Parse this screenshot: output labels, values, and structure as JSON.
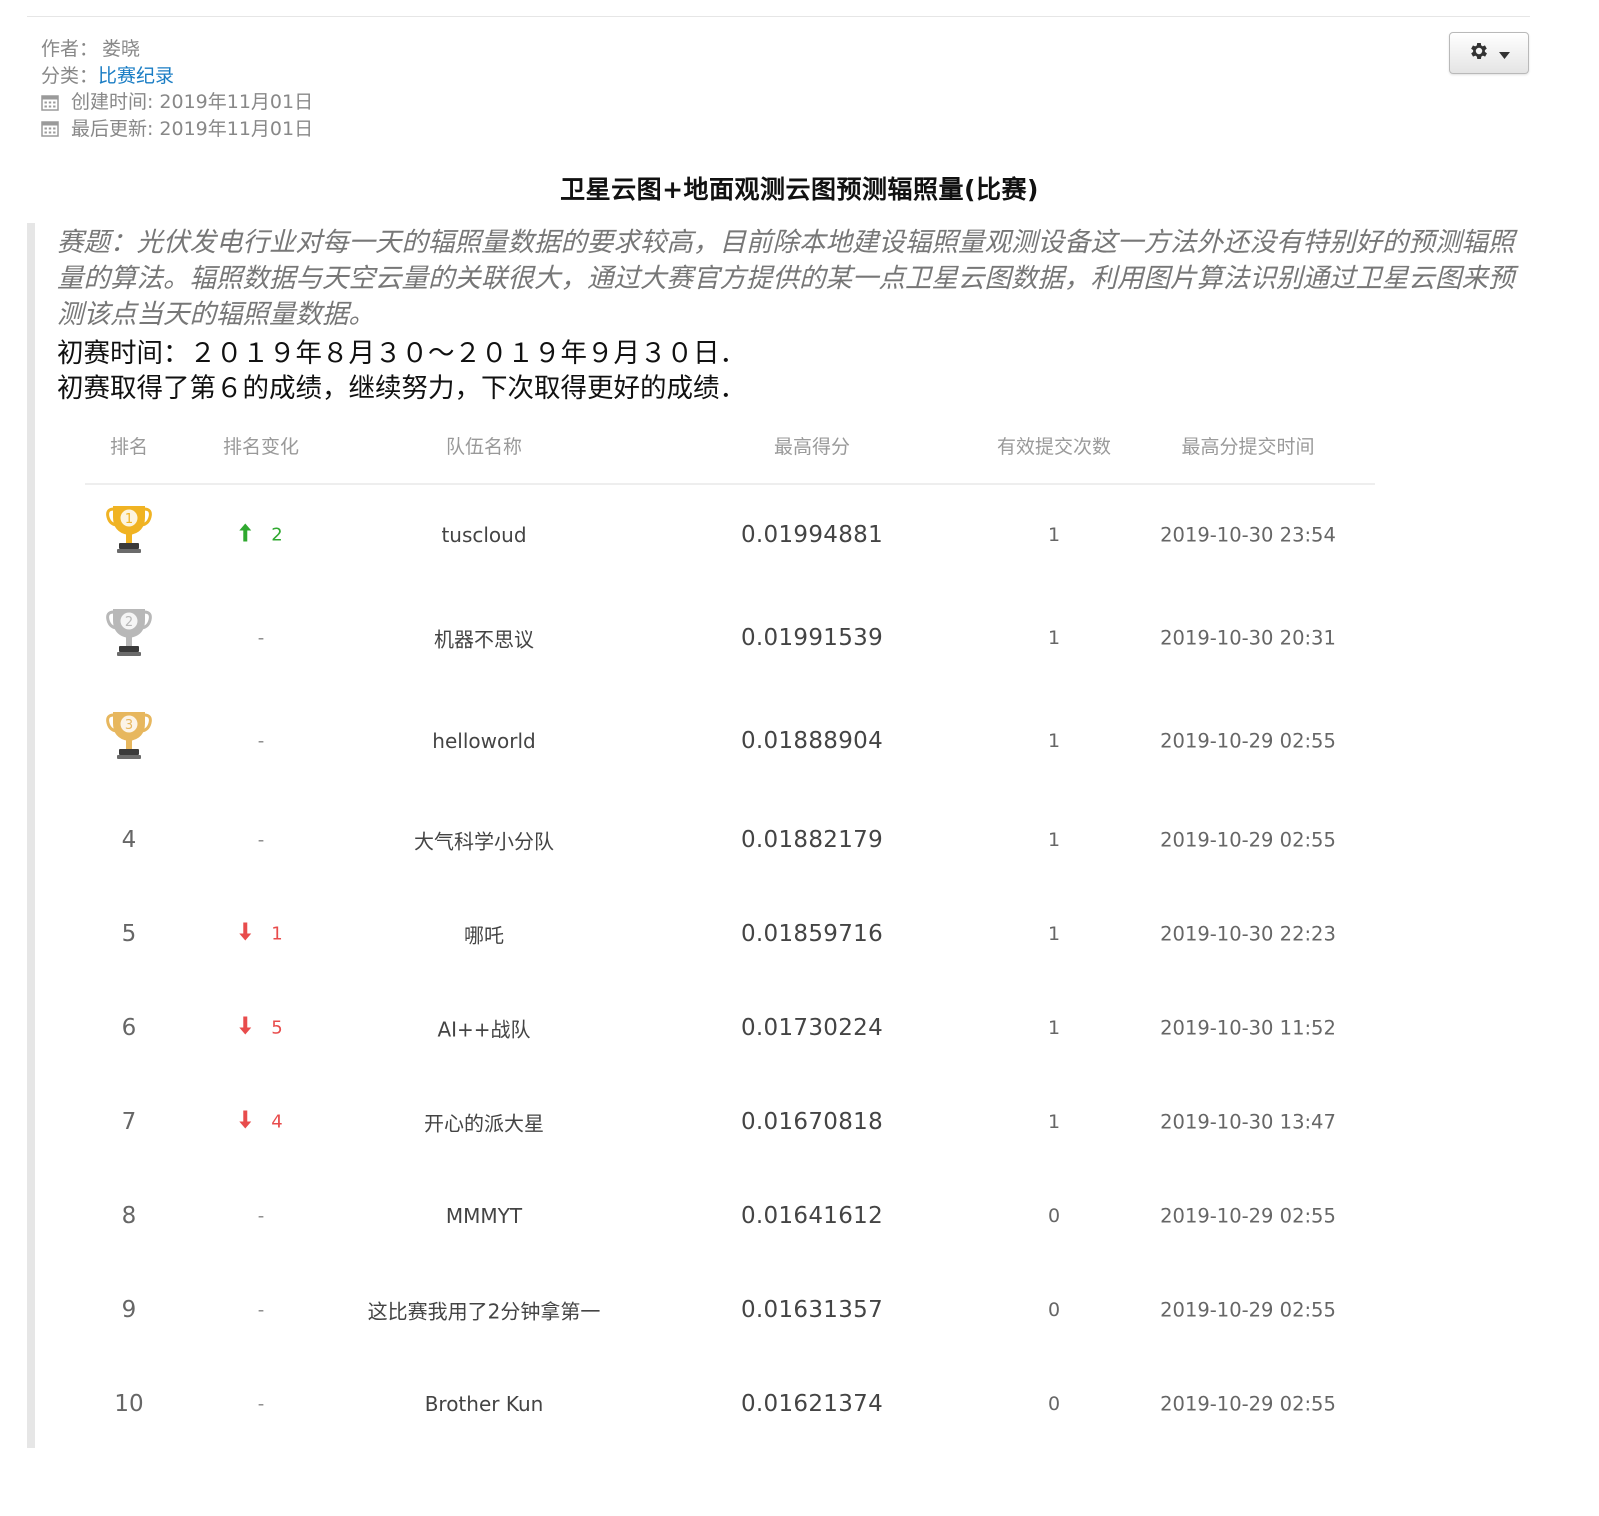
{
  "meta": {
    "author_label": "作者：",
    "author": "娄晓",
    "category_label": "分类：",
    "category": "比赛纪录",
    "created_label": "创建时间:",
    "created": "2019年11月01日",
    "updated_label": "最后更新:",
    "updated": "2019年11月01日",
    "calendar_icon": "calendar-icon"
  },
  "toolbar": {
    "gear_icon": "gear-icon",
    "caret_icon": "caret-down-icon"
  },
  "article": {
    "title": "卫星云图+地面观测云图预测辐照量(比赛)",
    "intro": "赛题：光伏发电行业对每一天的辐照量数据的要求较高，目前除本地建设辐照量观测设备这一方法外还没有特别好的预测辐照量的算法。辐照数据与天空云量的关联很大，通过大赛官方提供的某一点卫星云图数据，利用图片算法识别通过卫星云图来预测该点当天的辐照量数据。",
    "prelim_time": "初赛时间：２０１９年８月３０～２０１９年９月３０日．",
    "result": "初赛取得了第６的成绩，继续努力，下次取得更好的成绩．"
  },
  "leaderboard": {
    "headers": {
      "rank": "排名",
      "change": "排名变化",
      "team": "队伍名称",
      "score": "最高得分",
      "submissions": "有效提交次数",
      "time": "最高分提交时间"
    },
    "colors": {
      "up": "#2fa82f",
      "down": "#e84c4c",
      "gold": "#f0b323",
      "silver": "#b8b8b8",
      "bronze": "#e7b75e"
    },
    "rows": [
      {
        "rank": "1",
        "trophy": "gold-trophy-icon",
        "change_dir": "up",
        "change": "2",
        "team": "tuscloud",
        "score": "0.01994881",
        "submissions": "1",
        "time": "2019-10-30 23:54"
      },
      {
        "rank": "2",
        "trophy": "silver-trophy-icon",
        "change_dir": "none",
        "change": "-",
        "team": "机器不思议",
        "score": "0.01991539",
        "submissions": "1",
        "time": "2019-10-30 20:31"
      },
      {
        "rank": "3",
        "trophy": "bronze-trophy-icon",
        "change_dir": "none",
        "change": "-",
        "team": "helloworld",
        "score": "0.01888904",
        "submissions": "1",
        "time": "2019-10-29 02:55"
      },
      {
        "rank": "4",
        "change_dir": "none",
        "change": "-",
        "team": "大气科学小分队",
        "score": "0.01882179",
        "submissions": "1",
        "time": "2019-10-29 02:55"
      },
      {
        "rank": "5",
        "change_dir": "down",
        "change": "1",
        "team": "哪吒",
        "score": "0.01859716",
        "submissions": "1",
        "time": "2019-10-30 22:23"
      },
      {
        "rank": "6",
        "change_dir": "down",
        "change": "5",
        "team": "AI++战队",
        "score": "0.01730224",
        "submissions": "1",
        "time": "2019-10-30 11:52"
      },
      {
        "rank": "7",
        "change_dir": "down",
        "change": "4",
        "team": "开心的派大星",
        "score": "0.01670818",
        "submissions": "1",
        "time": "2019-10-30 13:47"
      },
      {
        "rank": "8",
        "change_dir": "none",
        "change": "-",
        "team": "MMMYT",
        "score": "0.01641612",
        "submissions": "0",
        "time": "2019-10-29 02:55"
      },
      {
        "rank": "9",
        "change_dir": "none",
        "change": "-",
        "team": "这比赛我用了2分钟拿第一",
        "score": "0.01631357",
        "submissions": "0",
        "time": "2019-10-29 02:55"
      },
      {
        "rank": "10",
        "change_dir": "none",
        "change": "-",
        "team": "Brother Kun",
        "score": "0.01621374",
        "submissions": "0",
        "time": "2019-10-29 02:55"
      }
    ]
  }
}
